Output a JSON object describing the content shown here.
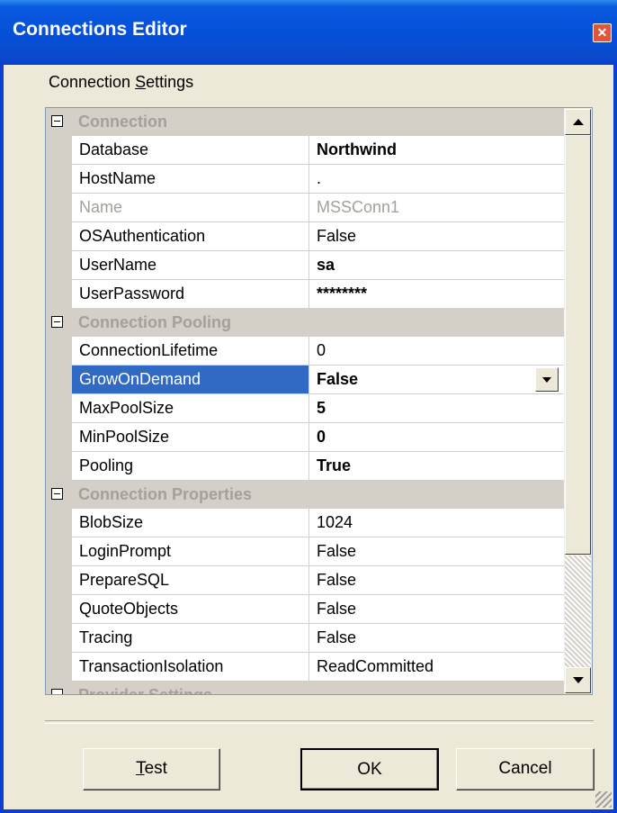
{
  "window": {
    "title": "Connections Editor"
  },
  "group": {
    "label_prefix": "Connection ",
    "label_key": "S",
    "label_suffix": "ettings"
  },
  "categories": [
    {
      "label": "Connection"
    },
    {
      "label": "Connection Pooling"
    },
    {
      "label": "Connection Properties"
    },
    {
      "label": "Provider Settings"
    }
  ],
  "properties": {
    "connection": [
      {
        "name": "Database",
        "value": "Northwind"
      },
      {
        "name": "HostName",
        "value": "."
      },
      {
        "name": "Name",
        "value": "MSSConn1"
      },
      {
        "name": "OSAuthentication",
        "value": "False"
      },
      {
        "name": "UserName",
        "value": "sa"
      },
      {
        "name": "UserPassword",
        "value": "********"
      }
    ],
    "pooling": [
      {
        "name": "ConnectionLifetime",
        "value": "0"
      },
      {
        "name": "GrowOnDemand",
        "value": "False"
      },
      {
        "name": "MaxPoolSize",
        "value": "5"
      },
      {
        "name": "MinPoolSize",
        "value": "0"
      },
      {
        "name": "Pooling",
        "value": "True"
      }
    ],
    "props": [
      {
        "name": "BlobSize",
        "value": "1024"
      },
      {
        "name": "LoginPrompt",
        "value": "False"
      },
      {
        "name": "PrepareSQL",
        "value": "False"
      },
      {
        "name": "QuoteObjects",
        "value": "False"
      },
      {
        "name": "Tracing",
        "value": "False"
      },
      {
        "name": "TransactionIsolation",
        "value": "ReadCommitted"
      }
    ]
  },
  "buttons": {
    "test_key": "T",
    "test_rest": "est",
    "ok": "OK",
    "cancel": "Cancel"
  },
  "colors": {
    "title_bar": "#0a5ae0",
    "selection": "#316ac5",
    "dialog_bg": "#ece9d8"
  }
}
